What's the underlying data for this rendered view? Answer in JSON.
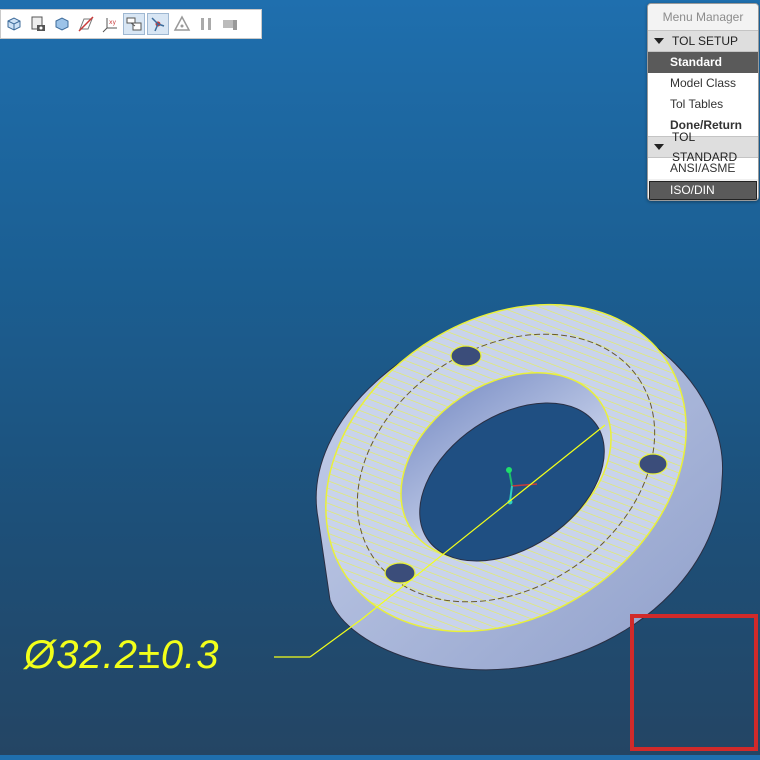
{
  "toolbar": {
    "icons": [
      {
        "name": "refit-icon",
        "active": false
      },
      {
        "name": "saved-views-icon",
        "active": false
      },
      {
        "name": "display-style-icon",
        "active": false
      },
      {
        "name": "datum-display-icon",
        "active": false
      },
      {
        "name": "csys-display-icon",
        "active": false
      },
      {
        "name": "annotation-display-icon",
        "active": true
      },
      {
        "name": "spin-center-icon",
        "active": true
      },
      {
        "name": "triangle-icon",
        "active": false
      },
      {
        "name": "pause-icon",
        "active": false
      },
      {
        "name": "flag-icon",
        "active": false
      }
    ]
  },
  "menu_manager": {
    "title": "Menu Manager",
    "sections": [
      {
        "label": "TOL SETUP",
        "items": [
          {
            "label": "Standard",
            "state": "selected"
          },
          {
            "label": "Model Class",
            "state": "normal"
          },
          {
            "label": "Tol Tables",
            "state": "normal"
          },
          {
            "label": "Done/Return",
            "state": "bold"
          }
        ]
      },
      {
        "label": "TOL STANDARD",
        "items": [
          {
            "label": "ANSI/ASME",
            "state": "normal"
          },
          {
            "label": "ISO/DIN",
            "state": "boxed"
          }
        ]
      }
    ]
  },
  "model": {
    "dimension_text": "Ø32.2±0.3"
  },
  "colors": {
    "background_top": "#1f6fae",
    "background_bottom": "#244564",
    "highlight": "#f2ff1a",
    "part": "#b8c6e4",
    "callout_box": "#d12a2a"
  }
}
